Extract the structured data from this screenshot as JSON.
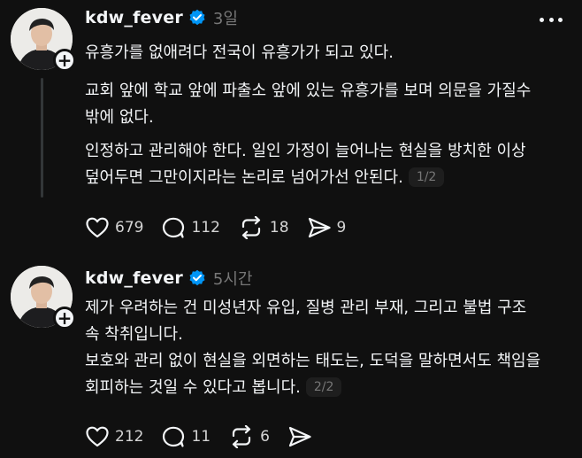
{
  "posts": [
    {
      "username": "kdw_fever",
      "timestamp": "3일",
      "paragraphs": [
        "유흥가를 없애려다 전국이 유흥가가 되고 있다.",
        "교회 앞에 학교 앞에 파출소 앞에 있는 유흥가를 보며 의문을 가질수 밖에 없다.",
        "인정하고 관리해야 한다. 일인 가정이 늘어나는 현실을 방치한 이상 덮어두면 그만이지라는 논리로 넘어가선 안된다."
      ],
      "page_indicator": "1/2",
      "actions": {
        "likes": "679",
        "replies": "112",
        "reposts": "18",
        "shares": "9"
      }
    },
    {
      "username": "kdw_fever",
      "timestamp": "5시간",
      "paragraphs": [
        "제가 우려하는 건 미성년자 유입, 질병 관리 부재, 그리고 불법 구조 속 착취입니다.",
        "보호와 관리 없이 현실을 외면하는 태도는, 도덕을 말하면서도 책임을 회피하는 것일 수 있다고 봅니다."
      ],
      "page_indicator": "2/2",
      "actions": {
        "likes": "212",
        "replies": "11",
        "reposts": "6",
        "shares": ""
      }
    }
  ],
  "icons": {
    "verified": "verified-badge-icon",
    "like": "heart-icon",
    "reply": "speech-bubble-icon",
    "repost": "repost-icon",
    "share": "paper-plane-icon",
    "more": "more-horizontal-icon",
    "follow": "plus-icon"
  },
  "colors": {
    "background": "#101010",
    "text": "#f3f5f7",
    "secondary": "#777777",
    "verified": "#0095f6",
    "thread_line": "#333638"
  }
}
